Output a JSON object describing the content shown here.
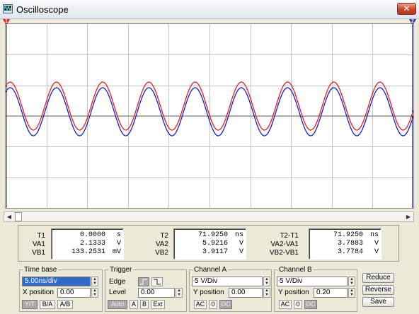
{
  "window": {
    "title": "Oscilloscope",
    "close_glyph": "✕",
    "icon": "oscilloscope-app-icon"
  },
  "markers": {
    "cursor1": "1",
    "cursor2": "2"
  },
  "colors": {
    "channel_a_trace": "#e02020",
    "channel_b_trace": "#1c1ccc",
    "grid": "#c4c4c4",
    "marker": "#d81e1e",
    "marker2": "#2a2a9c"
  },
  "readout": {
    "t1": {
      "label": "T1",
      "value": "0.0000",
      "unit": "s"
    },
    "va1": {
      "label": "VA1",
      "value": "2.1333",
      "unit": "V"
    },
    "vb1": {
      "label": "VB1",
      "value": "133.2531",
      "unit": "mV"
    },
    "t2": {
      "label": "T2",
      "value": "71.9250",
      "unit": "ns"
    },
    "va2": {
      "label": "VA2",
      "value": "5.9216",
      "unit": "V"
    },
    "vb2": {
      "label": "VB2",
      "value": "3.9117",
      "unit": "V"
    },
    "t2t1": {
      "label": "T2-T1",
      "value": "71.9250",
      "unit": "ns"
    },
    "va2va1": {
      "label": "VA2-VA1",
      "value": "3.7883",
      "unit": "V"
    },
    "vb2vb1": {
      "label": "VB2-VB1",
      "value": "3.7784",
      "unit": "V"
    }
  },
  "timebase": {
    "title": "Time base",
    "value": "5.00ns/div",
    "xpos_label": "X position",
    "xpos_value": "0.00",
    "modes": [
      "Y/T",
      "B/A",
      "A/B"
    ]
  },
  "trigger": {
    "title": "Trigger",
    "edge_label": "Edge",
    "edge_rising": "rising-edge-icon",
    "edge_falling": "falling-edge-icon",
    "level_label": "Level",
    "level_value": "0.00",
    "sources": [
      "Auto",
      "A",
      "B",
      "Ext"
    ]
  },
  "channel_a": {
    "title": "Channel A",
    "value": "5 V/Div",
    "ypos_label": "Y position",
    "ypos_value": "0.00",
    "coupling": [
      "AC",
      "0",
      "DC"
    ]
  },
  "channel_b": {
    "title": "Channel B",
    "value": "5 V/Div",
    "ypos_label": "Y position",
    "ypos_value": "0.20",
    "coupling": [
      "AC",
      "0",
      "DC"
    ]
  },
  "buttons": {
    "reduce": "Reduce",
    "reverse": "Reverse",
    "save": "Save"
  },
  "scroll": {
    "left": "◀",
    "right": "▶"
  },
  "spin": {
    "up": "▲",
    "down": "▼"
  }
}
